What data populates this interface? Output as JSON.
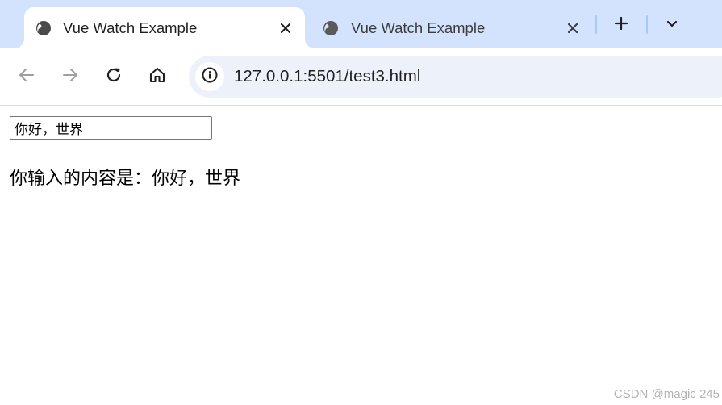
{
  "tabs": [
    {
      "title": "Vue Watch Example",
      "active": true,
      "icon": "globe-icon"
    },
    {
      "title": "Vue Watch Example",
      "active": false,
      "icon": "globe-icon"
    }
  ],
  "tabstrip": {
    "new_tab_icon": "plus-icon",
    "tab_search_icon": "chevron-down-icon"
  },
  "toolbar": {
    "back_icon": "arrow-left-icon",
    "forward_icon": "arrow-right-icon",
    "reload_icon": "reload-icon",
    "home_icon": "home-icon",
    "site_info_icon": "info-icon",
    "url": "127.0.0.1:5501/test3.html"
  },
  "page": {
    "input_value": "你好，世界",
    "output_text": "你输入的内容是：你好，世界"
  },
  "watermark": "CSDN @magic 245",
  "colors": {
    "tabstrip_bg": "#d3e3fd",
    "omnibox_bg": "#edf2fa",
    "tab_separator": "#a8c7fa"
  }
}
